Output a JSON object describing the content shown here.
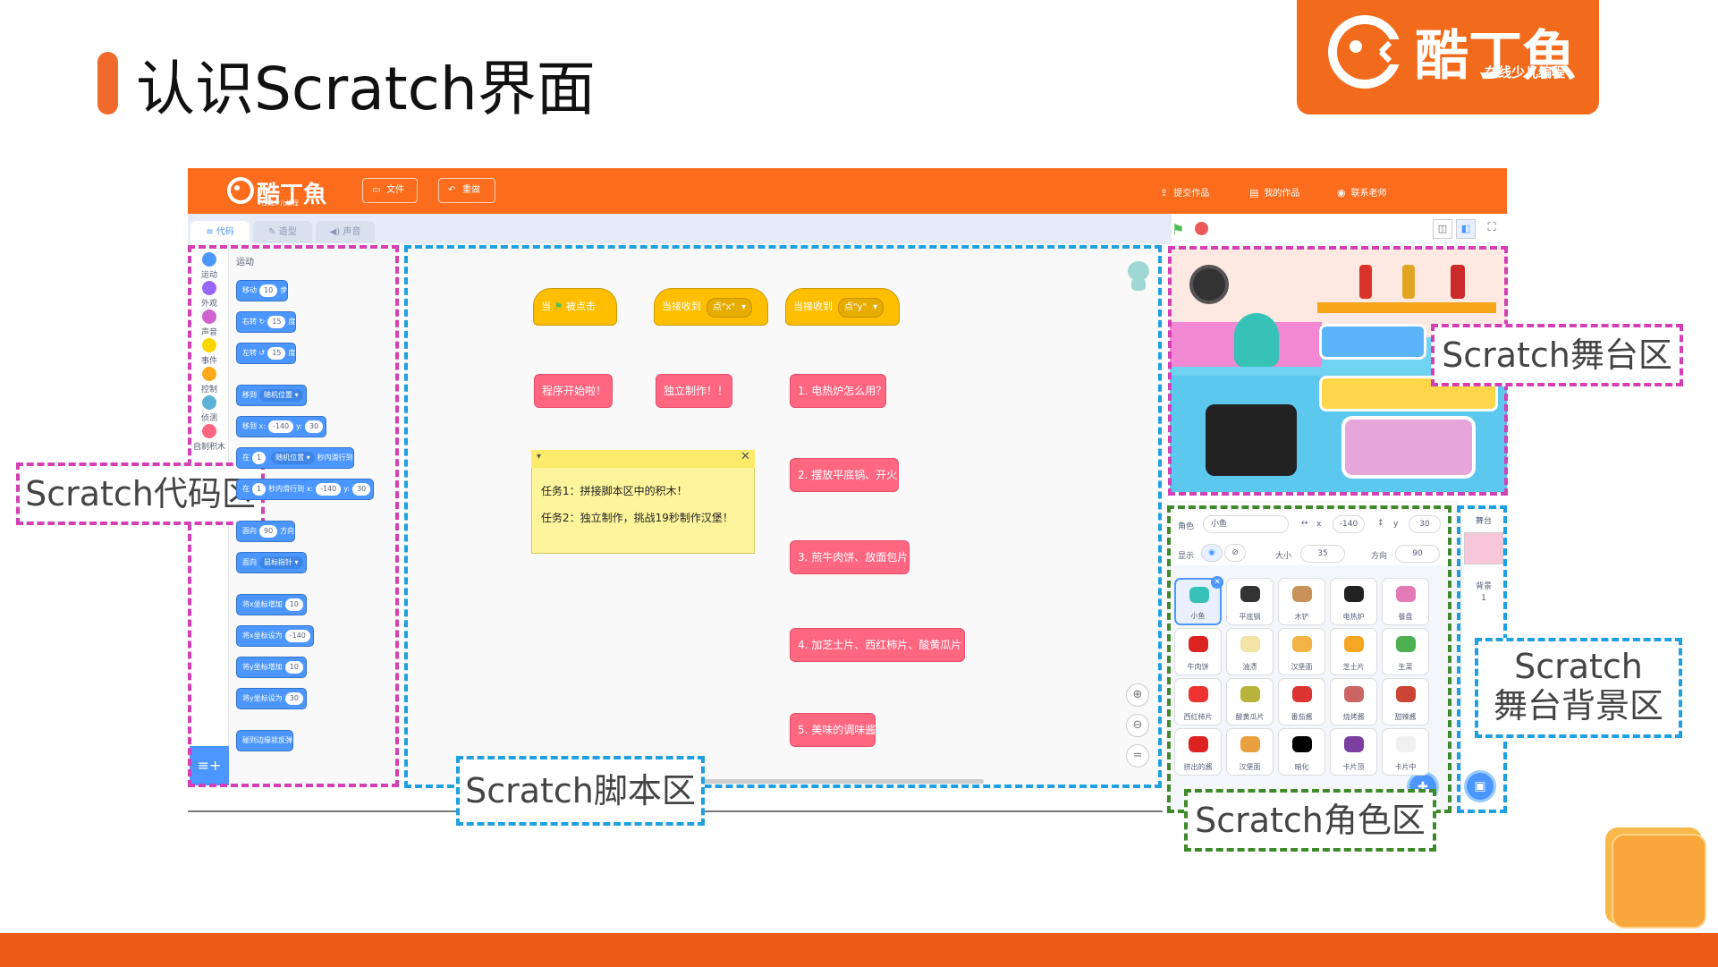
{
  "slide": {
    "title": "认识Scratch界面",
    "brand": {
      "name": "酷丁魚",
      "tagline": "在线少儿编程"
    }
  },
  "app": {
    "brand": {
      "name": "酷丁魚",
      "tagline": "在线少儿编程"
    },
    "toolbar": {
      "file": "文件",
      "redo": "重做",
      "submit": "提交作品",
      "my_works": "我的作品",
      "contact": "联系老师"
    },
    "tabs": [
      "代码",
      "造型",
      "声音"
    ],
    "categories": [
      {
        "label": "运动",
        "color": "#4c97ff"
      },
      {
        "label": "外观",
        "color": "#9966ff"
      },
      {
        "label": "声音",
        "color": "#cf63cf"
      },
      {
        "label": "事件",
        "color": "#ffd500"
      },
      {
        "label": "控制",
        "color": "#ffab19"
      },
      {
        "label": "侦测",
        "color": "#5cb1d6"
      },
      {
        "label": "自制积木",
        "color": "#ff6680"
      }
    ],
    "palette": {
      "heading": "运动",
      "blocks": [
        {
          "pre": "移动",
          "arg": "10",
          "post": "步"
        },
        {
          "pre": "右转 ↻",
          "arg": "15",
          "post": "度"
        },
        {
          "pre": "左转 ↺",
          "arg": "15",
          "post": "度"
        },
        {
          "pre": "移到",
          "drop": "随机位置 ▾",
          "post": ""
        },
        {
          "pre": "移到 x:",
          "arg": "-140",
          "post": "y:",
          "arg2": "30"
        },
        {
          "pre": "在",
          "arg": "1",
          "post": "秒内滑行到",
          "drop": "随机位置 ▾"
        },
        {
          "pre": "在",
          "arg": "1",
          "post": "秒内滑行到 x:",
          "arg2": "-140",
          "post2": "y:",
          "arg3": "30"
        },
        {
          "pre": "面向",
          "arg": "90",
          "post": "方向"
        },
        {
          "pre": "面向",
          "drop": "鼠标指针 ▾",
          "post": ""
        },
        {
          "pre": "将x坐标增加",
          "arg": "10",
          "post": ""
        },
        {
          "pre": "将x坐标设为",
          "arg": "-140",
          "post": ""
        },
        {
          "pre": "将y坐标增加",
          "arg": "10",
          "post": ""
        },
        {
          "pre": "将y坐标设为",
          "arg": "30",
          "post": ""
        },
        {
          "pre": "碰到边缘就反弹",
          "post": ""
        }
      ]
    },
    "scripts": {
      "hat1": {
        "pre": "当",
        "post": "被点击"
      },
      "hat2": {
        "pre": "当接收到",
        "drop": "点\"x\""
      },
      "hat3": {
        "pre": "当接收到",
        "drop": "点\"y\""
      },
      "stack1": "程序开始啦！",
      "stack2": "独立制作！！",
      "stack3": [
        "1. 电热炉怎么用？",
        "2. 摆放平底锅、开火",
        "3. 煎牛肉饼、放面包片",
        "4. 加芝士片、西红柿片、酸黄瓜片",
        "5. 美味的调味酱"
      ],
      "note": [
        "任务1：拼接脚本区中的积木！",
        "任务2：独立制作，挑战19秒制作汉堡！"
      ]
    },
    "sprite_info": {
      "sprite_label": "角色",
      "sprite_name": "小鱼",
      "x_label": "x",
      "x": "-140",
      "y_label": "y",
      "y": "30",
      "show_label": "显示",
      "size_label": "大小",
      "size": "35",
      "dir_label": "方向",
      "direction": "90"
    },
    "sprites": [
      "小鱼",
      "平底锅",
      "木铲",
      "电热炉",
      "餐盘",
      "牛肉饼",
      "油渍",
      "汉堡面",
      "芝士片",
      "生菜",
      "西红柿片",
      "酸黄瓜片",
      "番茄酱",
      "烧烤酱",
      "甜辣酱",
      "挤出的酱",
      "汉堡面",
      "暗化",
      "卡片顶",
      "卡片中"
    ],
    "backdrop": {
      "stage_label": "舞台",
      "backdrop_label": "背景",
      "count": "1"
    }
  },
  "callouts": {
    "code": "Scratch代码区",
    "script": "Scratch脚本区",
    "stage": "Scratch舞台区",
    "backdrop": [
      "Scratch",
      "舞台背景区"
    ],
    "sprite": "Scratch角色区"
  },
  "colors": {
    "brand_orange": "#f26b1d",
    "code_area_border": "#d43fb6",
    "script_area_border": "#1ea0e0",
    "sprite_area_border": "#3e8a2a"
  }
}
